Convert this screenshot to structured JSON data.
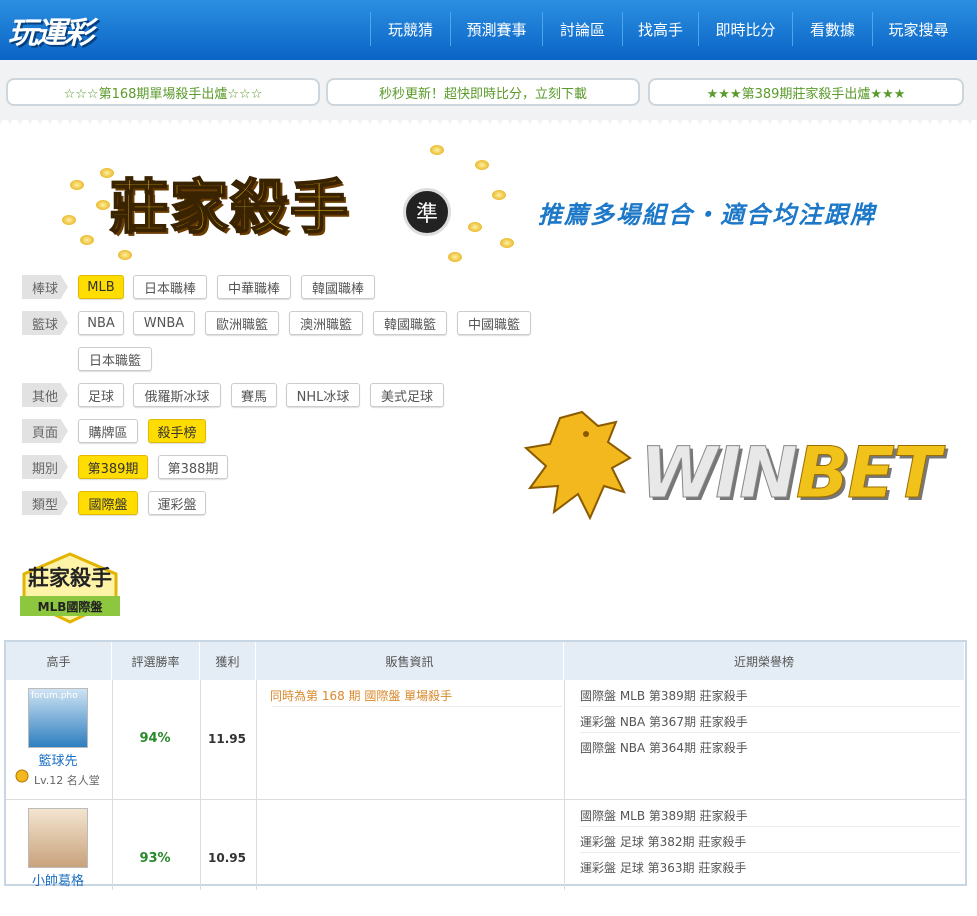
{
  "header": {
    "logo": "玩運彩",
    "nav": [
      "玩競猜",
      "預測賽事",
      "討論區",
      "找高手",
      "即時比分",
      "看數據",
      "玩家搜尋"
    ]
  },
  "announcements": [
    "☆☆☆第168期單場殺手出爐☆☆☆",
    "秒秒更新！超快即時比分，立刻下載",
    "★★★第389期莊家殺手出爐★★★"
  ],
  "banner": {
    "title": "莊家殺手",
    "badge": "準",
    "slogan": "推薦多場組合・適合均注跟牌"
  },
  "filters": {
    "baseball": {
      "label": "棒球",
      "options": [
        "MLB",
        "日本職棒",
        "中華職棒",
        "韓國職棒"
      ],
      "active": "MLB"
    },
    "basketball": {
      "label": "籃球",
      "options": [
        "NBA",
        "WNBA",
        "歐洲職籃",
        "澳洲職籃",
        "韓國職籃",
        "中國職籃",
        "日本職籃"
      ]
    },
    "other": {
      "label": "其他",
      "options": [
        "足球",
        "俄羅斯冰球",
        "賽馬",
        "NHL冰球",
        "美式足球"
      ]
    },
    "page": {
      "label": "頁面",
      "options": [
        "購牌區",
        "殺手榜"
      ],
      "active": "殺手榜"
    },
    "period": {
      "label": "期別",
      "options": [
        "第389期",
        "第388期"
      ],
      "active": "第389期"
    },
    "type": {
      "label": "類型",
      "options": [
        "國際盤",
        "運彩盤"
      ],
      "active": "國際盤"
    }
  },
  "sponsor": {
    "win": "WIN",
    "bet": "BET"
  },
  "section": {
    "title": "莊家殺手",
    "subtitle": "MLB國際盤"
  },
  "table": {
    "headers": [
      "高手",
      "評選勝率",
      "獲利",
      "販售資訊",
      "近期榮譽榜"
    ],
    "rows": [
      {
        "name": "籃球先",
        "avatar_text": "forum.pho",
        "level": "Lv.12 名人堂",
        "winrate": "94%",
        "profit": "11.95",
        "sale": "同時為第 168 期 國際盤 單場殺手",
        "honors": [
          "國際盤 MLB 第389期 莊家殺手",
          "運彩盤 NBA 第367期 莊家殺手",
          "國際盤 NBA 第364期 莊家殺手"
        ]
      },
      {
        "name": "小帥葛格",
        "winrate": "93%",
        "profit": "10.95",
        "sale": "",
        "honors": [
          "國際盤 MLB 第389期 莊家殺手",
          "運彩盤 足球 第382期 莊家殺手",
          "運彩盤 足球 第363期 莊家殺手"
        ]
      }
    ]
  },
  "colors": {
    "header_blue": "#0a64c6",
    "active_chip": "#ffdd00",
    "winrate_green": "#2a8a2a",
    "sale_orange": "#d9882a"
  }
}
